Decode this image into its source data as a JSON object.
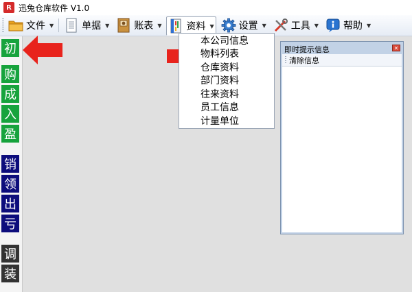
{
  "window": {
    "title": "迅兔仓库软件 V1.0",
    "app_icon_text": "R"
  },
  "toolbar": {
    "items": [
      {
        "label": "文件",
        "icon": "folder-icon"
      },
      {
        "label": "单据",
        "icon": "document-icon"
      },
      {
        "label": "账表",
        "icon": "ledger-book-icon"
      },
      {
        "label": "资料",
        "icon": "data-binder-icon"
      },
      {
        "label": "设置",
        "icon": "gear-icon"
      },
      {
        "label": "工具",
        "icon": "tools-icon"
      },
      {
        "label": "帮助",
        "icon": "info-help-icon"
      }
    ],
    "active": "资料"
  },
  "sidebar": {
    "items": [
      "初",
      "购",
      "成",
      "入",
      "盈",
      "销",
      "领",
      "出",
      "亏",
      "调",
      "装"
    ]
  },
  "dropdown": {
    "items": [
      "本公司信息",
      "物料列表",
      "仓库资料",
      "部门资料",
      "往来资料",
      "员工信息",
      "计量单位"
    ]
  },
  "panel": {
    "title": "即时提示信息",
    "clear_label": "清除信息"
  },
  "colors": {
    "green": "#17a33d",
    "navy": "#0d0d7c",
    "dark_gray": "#333333",
    "arrow_red": "#e8231c",
    "panel_blue": "#c2d2e6"
  }
}
